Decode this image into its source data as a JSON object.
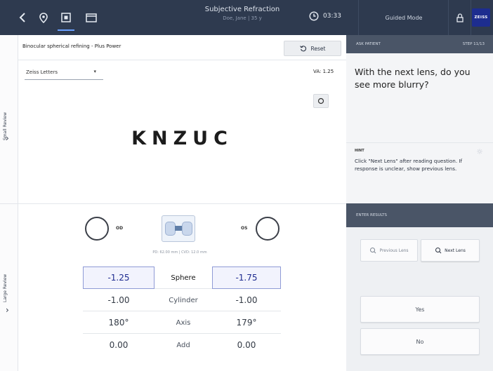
{
  "topbar": {
    "title": "Subjective Refraction",
    "subtitle": "Doe, Jane | 35 y",
    "timer": "03:33",
    "mode": "Guided Mode",
    "logo": "ZEISS",
    "icons": [
      "back-chevron-icon",
      "location-pin-icon",
      "exam-screen-icon",
      "monitor-icon",
      "clock-icon",
      "lock-icon"
    ]
  },
  "left_strips": {
    "small_review": "Small Review",
    "large_review": "Large Review"
  },
  "test": {
    "title": "Binocular spherical refining - Plus Power",
    "reset_label": "Reset",
    "chart_select": "Zeiss Letters",
    "va": "VA: 1.25",
    "optotypes": "KNZUC"
  },
  "phoropter": {
    "od_label": "OD",
    "os_label": "OS",
    "pd_text": "PD: 62.00 mm | CVD: 12.0 mm",
    "rows": [
      {
        "label": "Sphere",
        "od": "-1.25",
        "os": "-1.75",
        "highlight": true
      },
      {
        "label": "Cylinder",
        "od": "-1.00",
        "os": "-1.00",
        "highlight": false
      },
      {
        "label": "Axis",
        "od": "180°",
        "os": "179°",
        "highlight": false
      },
      {
        "label": "Add",
        "od": "0.00",
        "os": "0.00",
        "highlight": false
      }
    ]
  },
  "ask_patient": {
    "header": "ASK PATIENT",
    "step": "STEP 11/13",
    "question": "With the next lens, do you see more blurry?",
    "hint_label": "HINT",
    "hint_text": "Click \"Next Lens\" after reading question. If response is unclear, show previous lens."
  },
  "enter_results": {
    "header": "ENTER RESULTS",
    "previous_lens": "Previous Lens",
    "next_lens": "Next Lens",
    "yes": "Yes",
    "no": "No"
  },
  "colors": {
    "topbar": "#2e3a4f",
    "highlight_border": "#8f9bd6",
    "panel_header": "#4a5567",
    "logo": "#1d2d8f"
  }
}
